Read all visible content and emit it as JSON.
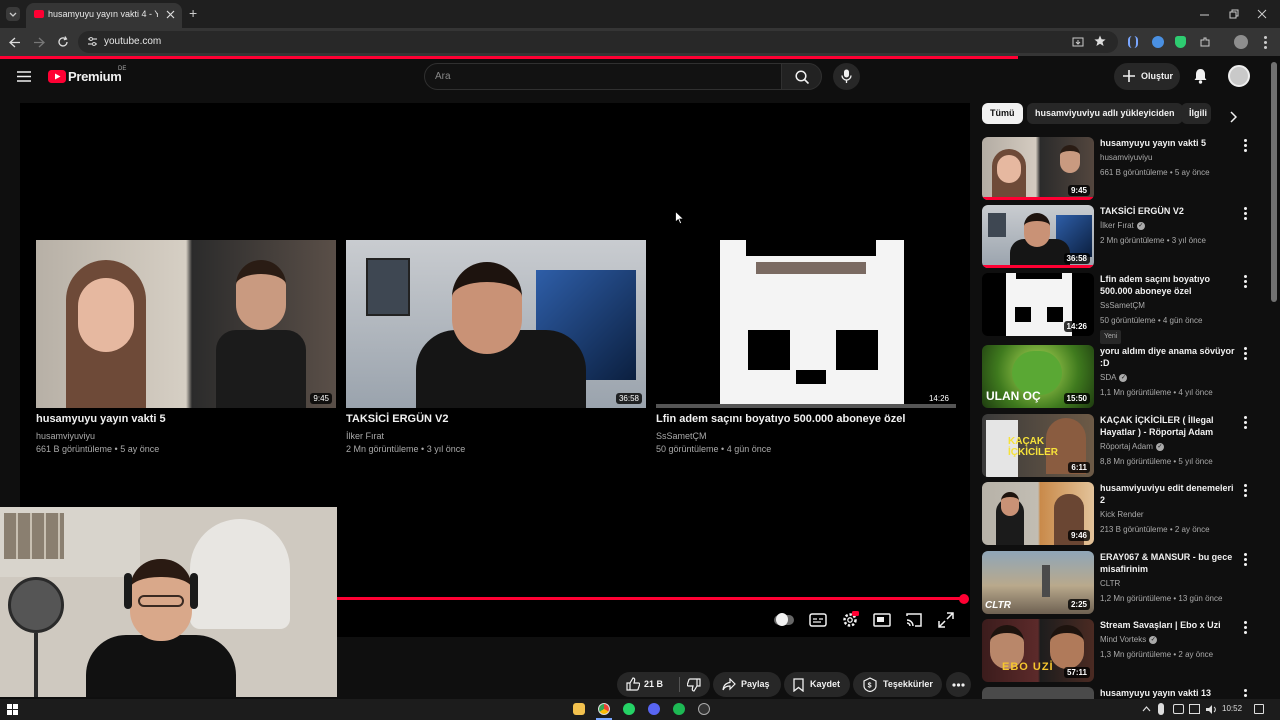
{
  "browser": {
    "tab_title": "husamyuyu yayın vakti 4 - YouT",
    "url": "youtube.com",
    "new_tab": "+"
  },
  "header": {
    "brand": "Premium",
    "region": "DE",
    "search_placeholder": "Ara",
    "create_label": "Oluştur"
  },
  "endscreen": [
    {
      "title": "husamyuyu yayın vakti 5",
      "channel": "husamviyuviyu",
      "meta": "661 B görüntüleme • 5 ay önce",
      "duration": "9:45"
    },
    {
      "title": "TAKSİCİ ERGÜN V2",
      "channel": "İlker Fırat",
      "meta": "2 Mn görüntüleme • 3 yıl önce",
      "duration": "36:58"
    },
    {
      "title": "Lfin adem saçını boyatıyo 500.000 aboneye özel",
      "channel": "SsSametÇM",
      "meta": "50 görüntüleme • 4 gün önce",
      "duration": "14:26"
    }
  ],
  "actions": {
    "like_count": "21 B",
    "share": "Paylaş",
    "save": "Kaydet",
    "thanks": "Teşekkürler"
  },
  "chips": [
    "Tümü",
    "husamviyuviyu adlı yükleyiciden",
    "İlgili"
  ],
  "sidebar": [
    {
      "title": "husamyuyu yayın vakti 5",
      "channel": "husamviyuviyu",
      "verified": false,
      "meta": "661 B görüntüleme • 5 ay önce",
      "duration": "9:45",
      "badge": ""
    },
    {
      "title": "TAKSİCİ ERGÜN V2",
      "channel": "İlker Fırat",
      "verified": true,
      "meta": "2 Mn görüntüleme • 3 yıl önce",
      "duration": "36:58",
      "badge": ""
    },
    {
      "title": "Lfin adem saçını boyatıyo 500.000 aboneye özel",
      "channel": "SsSametÇM",
      "verified": false,
      "meta": "50 görüntüleme • 4 gün önce",
      "duration": "14:26",
      "badge": "Yeni"
    },
    {
      "title": "yoru aldım diye anama sövüyor :D",
      "channel": "SDA",
      "verified": true,
      "meta": "1,1 Mn görüntüleme • 4 yıl önce",
      "duration": "15:50",
      "badge": "",
      "thumb_text": "ULAN OÇ"
    },
    {
      "title": "KAÇAK İÇKİCİLER ( İllegal Hayatlar ) - Röportaj Adam",
      "channel": "Röportaj Adam",
      "verified": true,
      "meta": "8,8 Mn görüntüleme • 5 yıl önce",
      "duration": "6:11",
      "badge": "",
      "thumb_text": "KAÇAK İÇKİCİLER"
    },
    {
      "title": "husamviyuviyu edit denemeleri 2",
      "channel": "Kick Render",
      "verified": false,
      "meta": "213 B görüntüleme • 2 ay önce",
      "duration": "9:46",
      "badge": ""
    },
    {
      "title": "ERAY067 & MANSUR - bu gece misafirinim",
      "channel": "CLTR",
      "verified": false,
      "meta": "1,2 Mn görüntüleme • 13 gün önce",
      "duration": "2:25",
      "badge": "",
      "thumb_text": "CLTR"
    },
    {
      "title": "Stream Savaşları | Ebo x Uzi",
      "channel": "Mind Vorteks",
      "verified": true,
      "meta": "1,3 Mn görüntüleme • 2 ay önce",
      "duration": "57:11",
      "badge": "",
      "thumb_text": "EBO UZİ"
    },
    {
      "title": "husamyuyu yayın vakti 13",
      "channel": "",
      "verified": false,
      "meta": "",
      "duration": "",
      "badge": ""
    }
  ],
  "taskbar": {
    "time": "10:52"
  },
  "colors": {
    "accent": "#ff0033",
    "background": "#0f0f0f"
  }
}
